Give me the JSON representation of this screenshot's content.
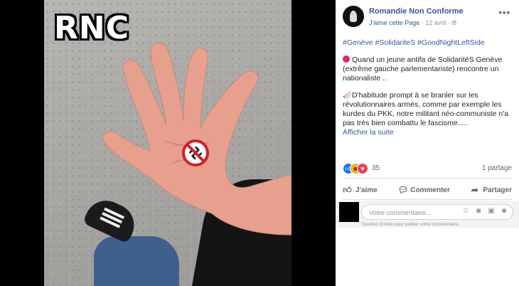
{
  "photo": {
    "overlay_text": "RNC",
    "sticker_icon": "crossed-out-swastika-icon"
  },
  "post": {
    "page_name": "Romandie Non Conforme",
    "like_page": "J'aime cette Page",
    "separator": " · ",
    "date": "12 avril",
    "separator2": " · ",
    "audience_icon": "globe-icon",
    "more_icon": "ellipsis-icon",
    "hashtags": "#Genève #SolidariteS #GoodNightLeftSide",
    "paragraph1": "Quand un jeune antifa de SolidaritéS Genève (extrême gauche parlementariste) rencontre un nationaliste ..",
    "paragraph2": "D'habitude prompt à se branler sur les révolutionnaires armés, comme par exemple les kurdes du PKK, notre militant néo-communiste n'a pas très bien combattu le fascisme.....",
    "see_more": "Afficher la suite",
    "paragraph1_icon": "red-circle-icon",
    "paragraph2_icon": "violin-icon"
  },
  "engagement": {
    "reaction_icons": [
      "like-icon",
      "haha-icon",
      "love-icon"
    ],
    "reaction_count": "35",
    "shares": "1 partage"
  },
  "actions": {
    "like": "J'aime",
    "comment": "Commenter",
    "share": "Partager"
  },
  "comment_box": {
    "placeholder": "Votre commentaire...",
    "hint": "Touchez Entrée pour publier votre commentaire.",
    "icons": [
      "emoji-icon",
      "camera-icon",
      "gif-icon",
      "sticker-icon"
    ]
  }
}
